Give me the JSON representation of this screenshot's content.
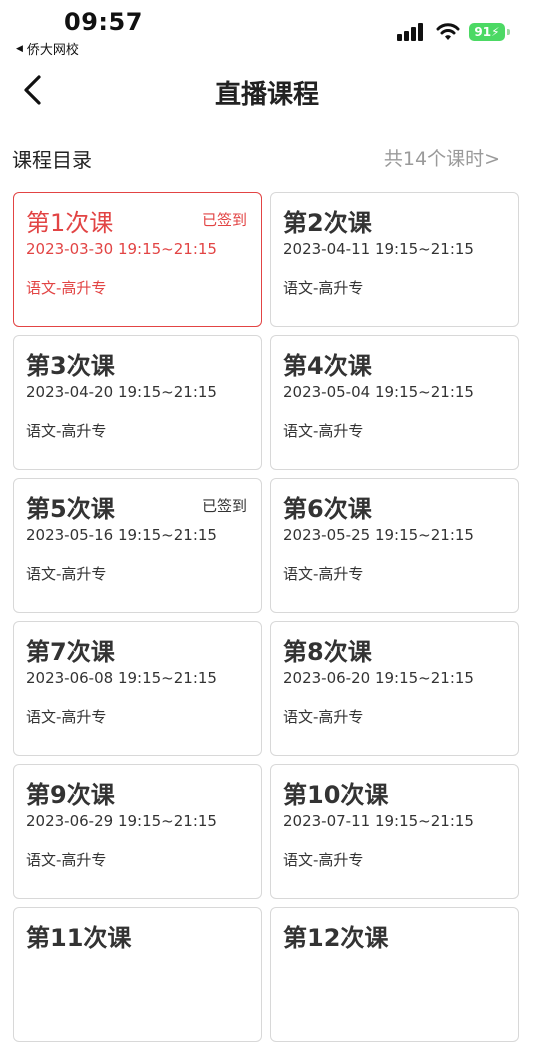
{
  "status": {
    "time": "09:57",
    "back_app": "侨大网校",
    "battery": "91"
  },
  "nav": {
    "title": "直播课程"
  },
  "section": {
    "title": "课程目录",
    "count": "共14个课时>"
  },
  "lessons": [
    {
      "name": "第1次课",
      "date": "2023-03-30 19:15~21:15",
      "course": "语文-高升专",
      "signed": "已签到",
      "active": true
    },
    {
      "name": "第2次课",
      "date": "2023-04-11 19:15~21:15",
      "course": "语文-高升专",
      "signed": "",
      "active": false
    },
    {
      "name": "第3次课",
      "date": "2023-04-20 19:15~21:15",
      "course": "语文-高升专",
      "signed": "",
      "active": false
    },
    {
      "name": "第4次课",
      "date": "2023-05-04 19:15~21:15",
      "course": "语文-高升专",
      "signed": "",
      "active": false
    },
    {
      "name": "第5次课",
      "date": "2023-05-16 19:15~21:15",
      "course": "语文-高升专",
      "signed": "已签到",
      "active": false
    },
    {
      "name": "第6次课",
      "date": "2023-05-25 19:15~21:15",
      "course": "语文-高升专",
      "signed": "",
      "active": false
    },
    {
      "name": "第7次课",
      "date": "2023-06-08 19:15~21:15",
      "course": "语文-高升专",
      "signed": "",
      "active": false
    },
    {
      "name": "第8次课",
      "date": "2023-06-20 19:15~21:15",
      "course": "语文-高升专",
      "signed": "",
      "active": false
    },
    {
      "name": "第9次课",
      "date": "2023-06-29 19:15~21:15",
      "course": "语文-高升专",
      "signed": "",
      "active": false
    },
    {
      "name": "第10次课",
      "date": "2023-07-11 19:15~21:15",
      "course": "语文-高升专",
      "signed": "",
      "active": false
    },
    {
      "name": "第11次课",
      "date": "",
      "course": "",
      "signed": "",
      "active": false
    },
    {
      "name": "第12次课",
      "date": "",
      "course": "",
      "signed": "",
      "active": false
    }
  ],
  "colors": {
    "accent": "#e24444",
    "battery": "#4cd964",
    "muted": "#9a9a9a"
  }
}
